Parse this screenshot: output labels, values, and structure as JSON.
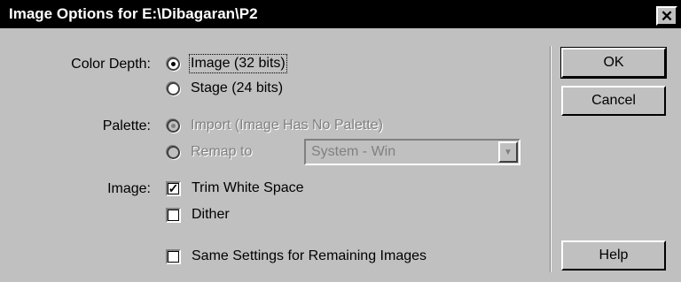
{
  "window": {
    "title": "Image Options for E:\\Dibagaran\\P2",
    "close_glyph": "✕"
  },
  "color_depth": {
    "label": "Color Depth:",
    "options": [
      {
        "label": "Image (32 bits)",
        "checked": true,
        "enabled": true
      },
      {
        "label": "Stage (24 bits)",
        "checked": false,
        "enabled": true
      }
    ]
  },
  "palette": {
    "label": "Palette:",
    "options": [
      {
        "label": "Import (Image Has No Palette)",
        "checked": true,
        "enabled": false
      },
      {
        "label": "Remap to",
        "checked": false,
        "enabled": false
      }
    ],
    "remap_select": {
      "value": "System - Win",
      "enabled": false
    }
  },
  "image": {
    "label": "Image:",
    "trim_white_space": {
      "label": "Trim White Space",
      "checked": true
    },
    "dither": {
      "label": "Dither",
      "checked": false
    }
  },
  "same_settings": {
    "label": "Same Settings for Remaining Images",
    "checked": false
  },
  "buttons": {
    "ok": "OK",
    "cancel": "Cancel",
    "help": "Help"
  },
  "icons": {
    "radio": "radio-button-icon",
    "checkbox": "checkbox-icon",
    "dropdown": "chevron-down-icon",
    "close": "close-icon"
  }
}
